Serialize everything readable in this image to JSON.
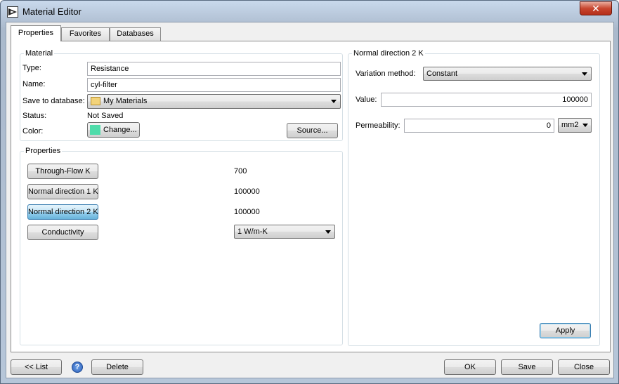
{
  "window": {
    "title": "Material Editor",
    "close_glyph": "✕"
  },
  "tabs": [
    {
      "label": "Properties",
      "active": true
    },
    {
      "label": "Favorites",
      "active": false
    },
    {
      "label": "Databases",
      "active": false
    }
  ],
  "material": {
    "group_title": "Material",
    "type_label": "Type:",
    "type_value": "Resistance",
    "name_label": "Name:",
    "name_value": "cyl-filter",
    "save_label": "Save to database:",
    "save_value": "My Materials",
    "status_label": "Status:",
    "status_value": "Not Saved",
    "color_label": "Color:",
    "color_button": "Change...",
    "color_swatch": "#4fdcaa",
    "source_button": "Source..."
  },
  "properties": {
    "group_title": "Properties",
    "rows": [
      {
        "button": "Through-Flow K",
        "value": "700"
      },
      {
        "button": "Normal direction 1 K",
        "value": "100000"
      },
      {
        "button": "Normal direction 2 K",
        "value": "100000",
        "selected": true
      },
      {
        "button": "Conductivity",
        "value": "1 W/m-K"
      }
    ]
  },
  "detail": {
    "group_title": "Normal direction 2 K",
    "variation_label": "Variation method:",
    "variation_value": "Constant",
    "value_label": "Value:",
    "value_value": "100000",
    "perm_label": "Permeability:",
    "perm_value": "0",
    "perm_unit": "mm2",
    "apply_button": "Apply"
  },
  "bottom": {
    "list_button": "<< List",
    "help_glyph": "?",
    "delete_button": "Delete",
    "ok_button": "OK",
    "save_button": "Save",
    "close_button": "Close"
  },
  "colors": {
    "accent": "#3c7fb1",
    "selected_button": "#98d1ef"
  }
}
